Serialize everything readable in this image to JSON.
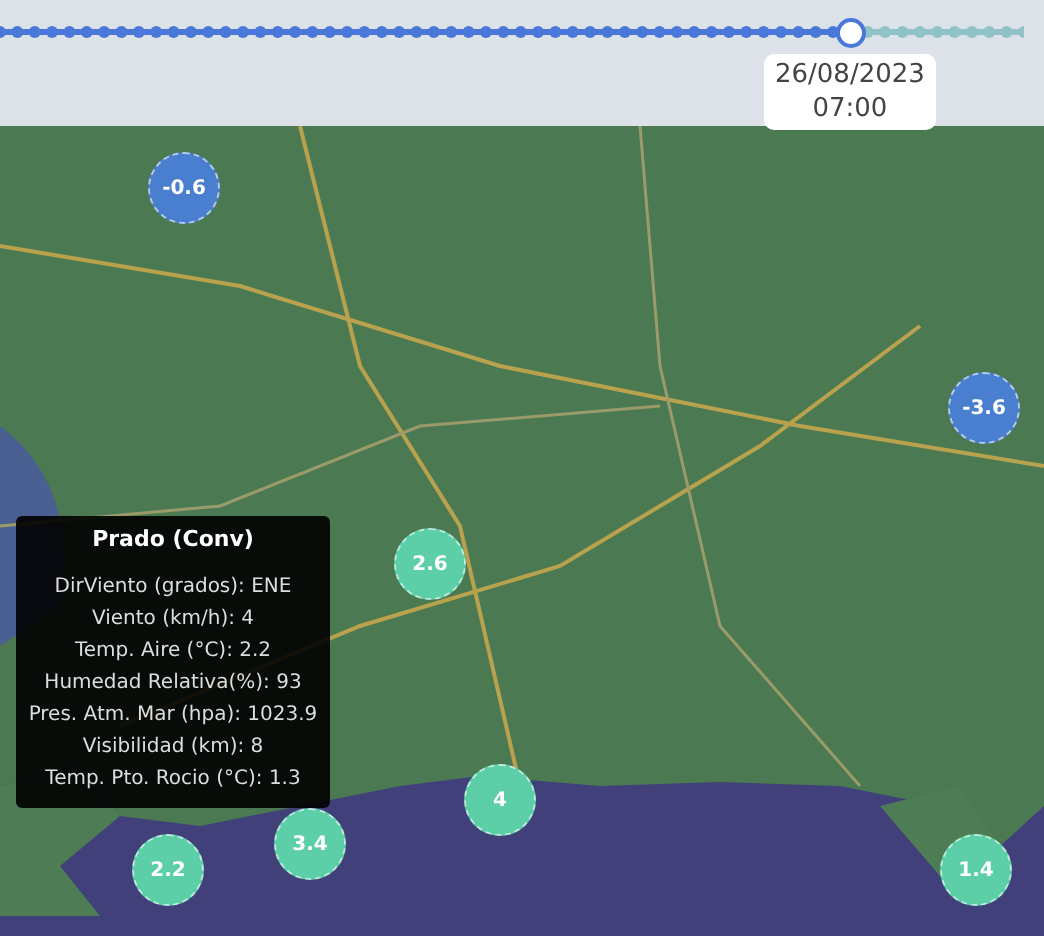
{
  "timeline": {
    "level": 0.83,
    "current_time": [
      "26/08/2023",
      "07:00"
    ]
  },
  "markers": [
    {
      "value": "-0.6",
      "color": "#4a7fd0"
    },
    {
      "value": "-3.6",
      "color": "#4a7fd0"
    },
    {
      "value": "2.6",
      "color": "#5ccfa8"
    },
    {
      "value": "4",
      "color": "#5ccfa8"
    },
    {
      "value": "3.4",
      "color": "#5ccfa8"
    },
    {
      "value": "2.2",
      "color": "#5ccfa8"
    },
    {
      "value": "1.4",
      "color": "#5ccfa8"
    }
  ],
  "popup": {
    "title": "Prado (Conv)",
    "lines": [
      "DirViento (grados): ENE",
      "Viento (km/h): 4",
      "Temp. Aire (°C): 2.2",
      "Humedad Relativa(%): 93",
      "Pres. Atm. Mar (hpa): 1023.9",
      "Visibilidad (km): 8",
      "Temp. Pto. Rocio (°C): 1.3"
    ]
  }
}
